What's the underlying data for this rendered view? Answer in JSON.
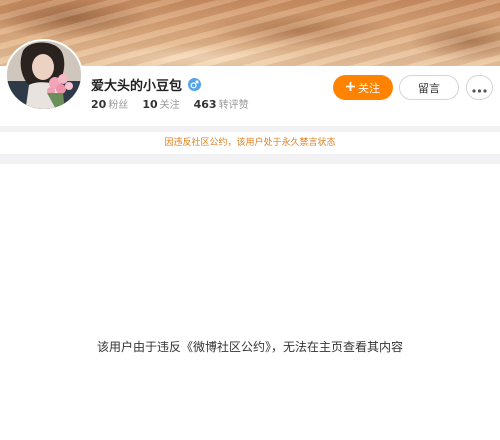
{
  "profile": {
    "username": "爱大头的小豆包",
    "gender_icon": "male-icon",
    "stats": [
      {
        "value": "20",
        "label": "粉丝"
      },
      {
        "value": "10",
        "label": "关注"
      },
      {
        "value": "463",
        "label": "转评赞"
      }
    ]
  },
  "actions": {
    "follow_label": "关注",
    "follow_icon": "plus-icon",
    "message_label": "留言",
    "more_icon": "more-dots-icon"
  },
  "notice": {
    "text": "因违反社区公约，该用户处于永久禁言状态"
  },
  "content": {
    "blocked_message": "该用户由于违反《微博社区公约》，无法在主页查看其内容"
  },
  "colors": {
    "accent": "#ff8200",
    "notice": "#e0801e",
    "gender": "#57a3e8"
  }
}
